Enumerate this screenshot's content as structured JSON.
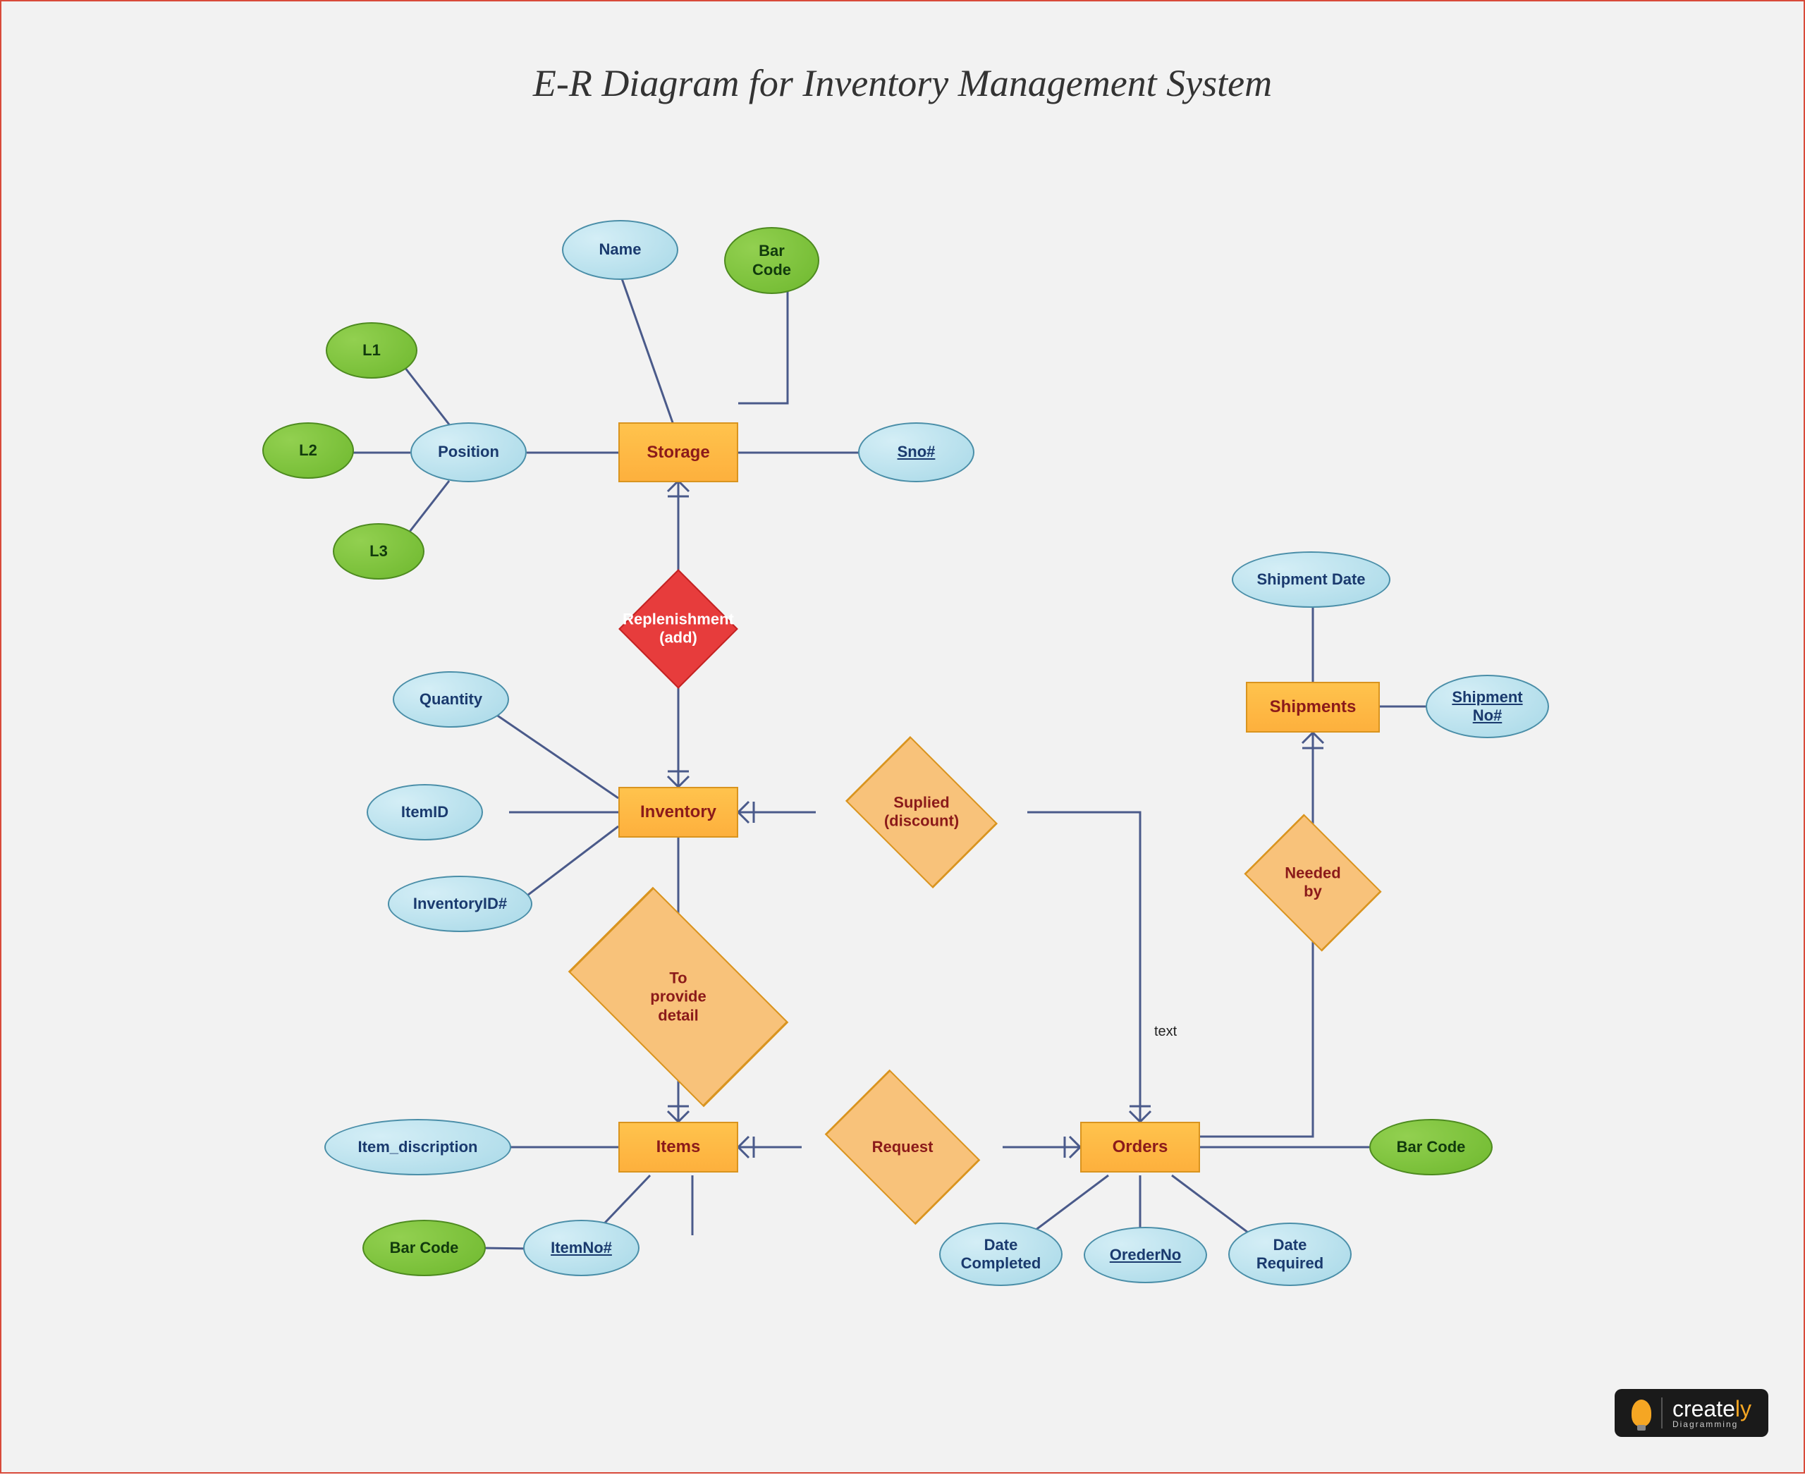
{
  "title": "E-R Diagram for Inventory Management System",
  "entities": {
    "storage": "Storage",
    "inventory": "Inventory",
    "items": "Items",
    "orders": "Orders",
    "shipments": "Shipments"
  },
  "relations": {
    "replenishment": "Replenishment\n(add)",
    "supplied": "Suplied\n(discount)",
    "provide_detail": "To provide detail",
    "request": "Request",
    "needed_by": "Needed by"
  },
  "attributes": {
    "name": "Name",
    "bar_code": "Bar\nCode",
    "position": "Position",
    "l1": "L1",
    "l2": "L2",
    "l3": "L3",
    "sno": "Sno#",
    "quantity": "Quantity",
    "item_id": "ItemID",
    "inventory_id": "InventoryID#",
    "shipment_date": "Shipment Date",
    "shipment_no": "Shipment\nNo#",
    "item_description": "Item_discription",
    "item_no": "ItemNo#",
    "bar_code_item": "Bar Code",
    "date_completed": "Date\nCompleted",
    "order_no": "OrederNo",
    "date_required": "Date\nRequired",
    "bar_code_orders": "Bar Code"
  },
  "annotations": {
    "text_note": "text"
  },
  "brand": {
    "name": "create",
    "suffix": "ly",
    "sub": "Diagramming"
  }
}
